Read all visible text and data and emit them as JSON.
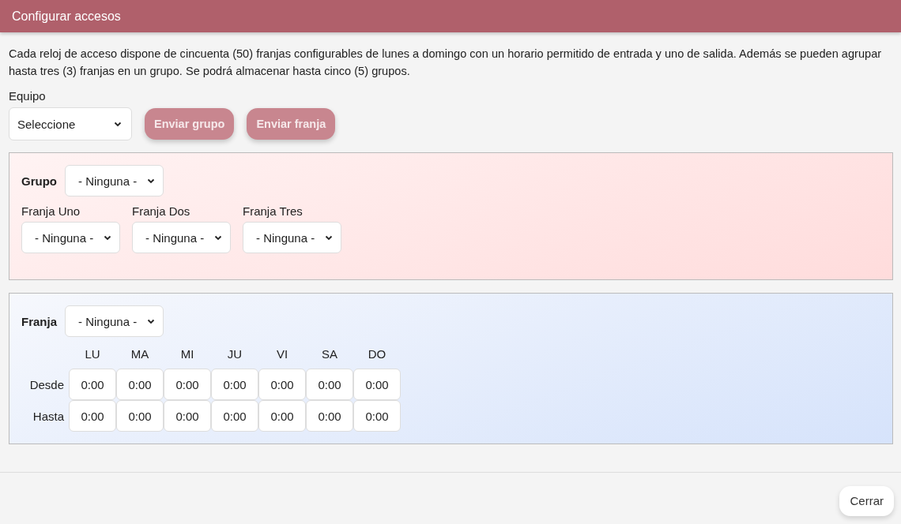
{
  "window": {
    "title": "Configurar accesos"
  },
  "description": "Cada reloj de acceso dispone de cincuenta (50) franjas configurables de lunes a domingo con un horario permitido de entrada y uno de salida. Además se pueden agrupar hasta tres (3) franjas en un grupo. Se podrá almacenar hasta cinco (5) grupos.",
  "equipo": {
    "label": "Equipo",
    "value": "Seleccione"
  },
  "actions": [
    {
      "label": "Enviar grupo",
      "disabled": true
    },
    {
      "label": "Enviar franja",
      "disabled": true
    }
  ],
  "grupo_panel": {
    "label": "Grupo",
    "value": "- Ninguna -",
    "franjas": [
      {
        "label": "Franja Uno",
        "value": "- Ninguna -"
      },
      {
        "label": "Franja Dos",
        "value": "- Ninguna -"
      },
      {
        "label": "Franja Tres",
        "value": "- Ninguna -"
      }
    ]
  },
  "franja_panel": {
    "label": "Franja",
    "value": "- Ninguna -",
    "days": [
      "LU",
      "MA",
      "MI",
      "JU",
      "VI",
      "SA",
      "DO"
    ],
    "rows": [
      {
        "label": "Desde",
        "times": [
          "0:00",
          "0:00",
          "0:00",
          "0:00",
          "0:00",
          "0:00",
          "0:00"
        ]
      },
      {
        "label": "Hasta",
        "times": [
          "0:00",
          "0:00",
          "0:00",
          "0:00",
          "0:00",
          "0:00",
          "0:00"
        ]
      }
    ]
  },
  "footer": {
    "close_label": "Cerrar"
  }
}
